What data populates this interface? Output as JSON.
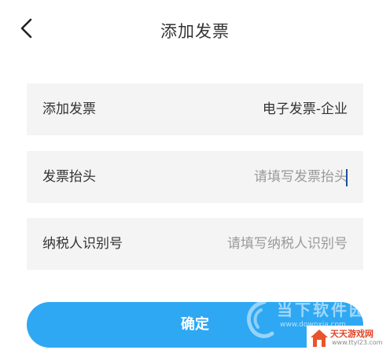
{
  "header": {
    "title": "添加发票"
  },
  "form": {
    "invoice_type": {
      "label": "添加发票",
      "value": "电子发票-企业"
    },
    "invoice_title": {
      "label": "发票抬头",
      "placeholder": "请填写发票抬头"
    },
    "taxpayer_id": {
      "label": "纳税人识别号",
      "placeholder": "请填写纳税人识别号"
    }
  },
  "confirm_label": "确定",
  "watermark": {
    "text": "当下软件园",
    "url": "www.downxia.com"
  },
  "corner_logo": {
    "text": "天天游戏网",
    "url": "www.ttyl23.com"
  },
  "colors": {
    "primary": "#2ea8f3",
    "field_bg": "#f4f4f4",
    "placeholder": "#9a9a9a",
    "caret": "#1a4fa0"
  }
}
